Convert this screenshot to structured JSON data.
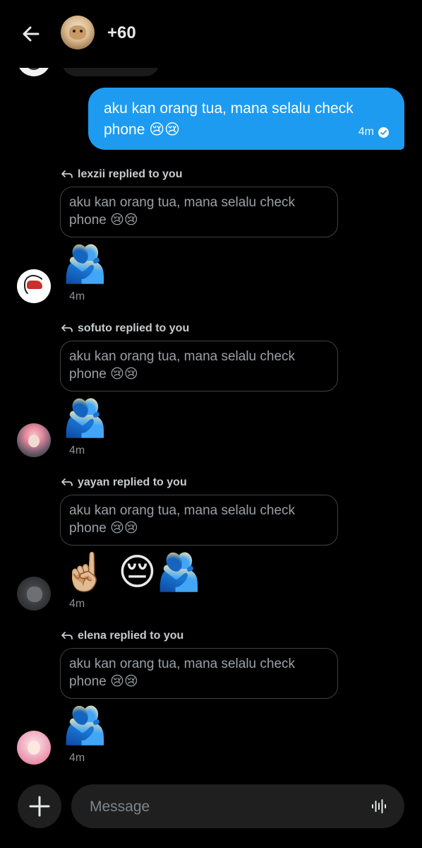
{
  "header": {
    "count_label": "+60"
  },
  "my_message": {
    "text": "aku kan orang tua, mana selalu check phone 😢😢",
    "time": "4m"
  },
  "replies": [
    {
      "header": "lexzii replied to you",
      "quote": "aku kan orang tua, mana selalu check phone 😢😢",
      "emoji": "🫂",
      "time": "4m"
    },
    {
      "header": "sofuto replied to you",
      "quote": "aku kan orang tua, mana selalu check phone 😢😢",
      "emoji": "🫂",
      "time": "4m"
    },
    {
      "header": "yayan replied to you",
      "quote": "aku kan orang tua, mana selalu check phone 😢😢",
      "emoji": "☝🏼 😔🫂",
      "time": "4m"
    },
    {
      "header": "elena replied to you",
      "quote": "aku kan orang tua, mana selalu check phone 😢😢",
      "emoji": "🫂",
      "time": "4m"
    }
  ],
  "composer": {
    "placeholder": "Message"
  },
  "icons": {
    "back": "arrow-left-icon",
    "reply": "reply-arrow-icon",
    "sent": "check-circle-icon",
    "add": "plus-icon",
    "voice": "waveform-icon"
  },
  "colors": {
    "accent": "#1d9bf0",
    "background": "#000000",
    "muted": "#8b9196"
  }
}
